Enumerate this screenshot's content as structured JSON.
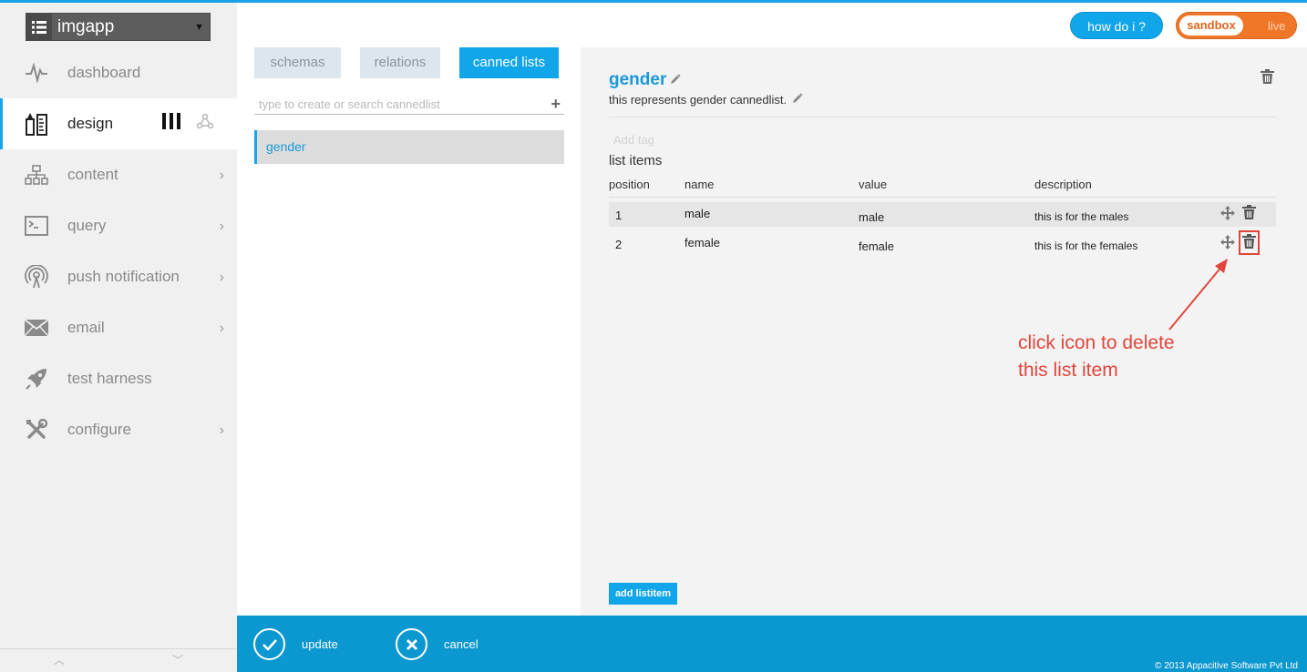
{
  "sidebar": {
    "app_name": "imgapp",
    "items": [
      {
        "label": "dashboard"
      },
      {
        "label": "design"
      },
      {
        "label": "content"
      },
      {
        "label": "query"
      },
      {
        "label": "push notification"
      },
      {
        "label": "email"
      },
      {
        "label": "test harness"
      },
      {
        "label": "configure"
      }
    ]
  },
  "header": {
    "how_do_i": "how do i ?",
    "env_sandbox": "sandbox",
    "env_live": "live"
  },
  "tabs": {
    "schemas": "schemas",
    "relations": "relations",
    "canned_lists": "canned lists"
  },
  "search": {
    "placeholder": "type to create or search cannedlist"
  },
  "list": {
    "selected": "gender"
  },
  "detail": {
    "title": "gender",
    "description": "this represents gender cannedlist.",
    "tag_placeholder": "Add tag",
    "list_items_heading": "list items",
    "columns": {
      "position": "position",
      "name": "name",
      "value": "value",
      "description": "description"
    },
    "rows": [
      {
        "position": "1",
        "name": "male",
        "value": "male",
        "description": "this is for the males"
      },
      {
        "position": "2",
        "name": "female",
        "value": "female",
        "description": "this is for the females"
      }
    ],
    "add_listitem": "add listitem"
  },
  "annotation": {
    "line1": "click icon to delete",
    "line2": "this list item",
    "color": "#e0463c"
  },
  "footer": {
    "update": "update",
    "cancel": "cancel",
    "copyright": "© 2013 Appacitive Software Pvt Ltd"
  },
  "colors": {
    "accent": "#1aa3e8",
    "bottom_bar": "#0b97cf",
    "env_toggle": "#f07628"
  }
}
